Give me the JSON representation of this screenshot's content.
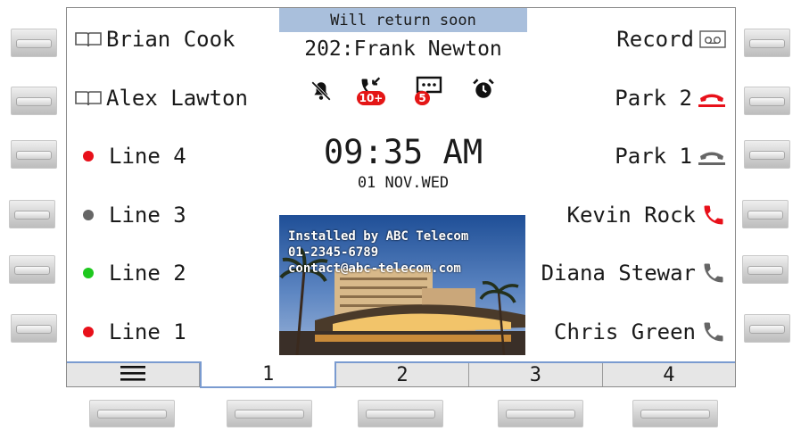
{
  "status_message": "Will return soon",
  "account": "202:Frank Newton",
  "status_icons": {
    "dnd": "bell-off-icon",
    "missed_calls": {
      "icon": "missed-call-icon",
      "badge": "10+"
    },
    "messages": {
      "icon": "message-icon",
      "badge": "5"
    },
    "alarm": "alarm-clock-icon"
  },
  "time": "09:35 AM",
  "date": "01 NOV.WED",
  "wallpaper": {
    "line1": "Installed by ABC Telecom",
    "line2": "01-2345-6789",
    "line3": "contact@abc-telecom.com"
  },
  "left_keys": [
    {
      "label": "Brian Cook",
      "icon": "contact-book-icon"
    },
    {
      "label": "Alex Lawton",
      "icon": "contact-book-icon"
    },
    {
      "label": "Line 4",
      "icon": "status-dot",
      "color": "#e8101a"
    },
    {
      "label": "Line 3",
      "icon": "status-dot",
      "color": "#666666"
    },
    {
      "label": "Line 2",
      "icon": "status-dot",
      "color": "#1ec81e"
    },
    {
      "label": "Line 1",
      "icon": "status-dot",
      "color": "#e8101a"
    }
  ],
  "right_keys": [
    {
      "label": "Record",
      "icon": "voicemail-icon"
    },
    {
      "label": "Park 2",
      "icon": "park-icon",
      "color": "#e8101a"
    },
    {
      "label": "Park 1",
      "icon": "park-icon",
      "color": "#666666"
    },
    {
      "label": "Kevin Rock",
      "icon": "phone-icon",
      "color": "#e8101a"
    },
    {
      "label": "Diana Stewar",
      "icon": "phone-icon",
      "color": "#666666"
    },
    {
      "label": "Chris Green",
      "icon": "phone-icon",
      "color": "#666666"
    }
  ],
  "tabs": [
    {
      "label": "",
      "icon": "menu-icon"
    },
    {
      "label": "1",
      "active": true
    },
    {
      "label": "2"
    },
    {
      "label": "3"
    },
    {
      "label": "4"
    }
  ],
  "colors": {
    "status_bar": "#a9bfdc",
    "tab_accent": "#7a9bd0",
    "red": "#e8101a"
  }
}
